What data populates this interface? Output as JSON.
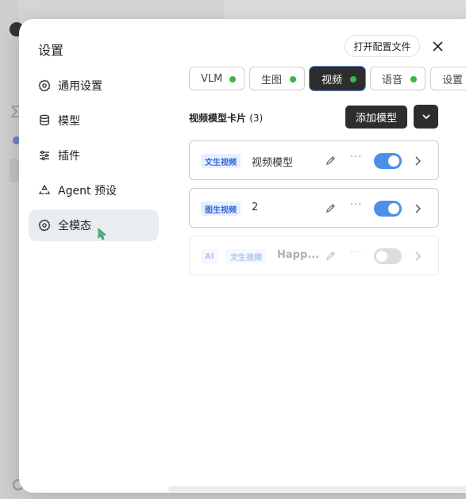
{
  "sidebar": {
    "title": "设置",
    "items": [
      {
        "label": "通用设置",
        "icon": "gear-icon"
      },
      {
        "label": "模型",
        "icon": "database-icon"
      },
      {
        "label": "插件",
        "icon": "sliders-icon"
      },
      {
        "label": "Agent 预设",
        "icon": "recycle-icon"
      },
      {
        "label": "全模态",
        "icon": "gear-icon",
        "active": true
      }
    ]
  },
  "header": {
    "open_config_label": "打开配置文件",
    "close_icon": "close-icon"
  },
  "tabs": [
    {
      "label": "VLM",
      "status": "green"
    },
    {
      "label": "生图",
      "status": "green"
    },
    {
      "label": "视频",
      "status": "green",
      "active": true
    },
    {
      "label": "语音",
      "status": "green"
    },
    {
      "label": "设置"
    }
  ],
  "section": {
    "title": "视频模型卡片",
    "count": "(3)",
    "add_model_label": "添加模型"
  },
  "cards": [
    {
      "badges": [
        "文生视频"
      ],
      "name": "视频模型",
      "enabled": true,
      "disabled": false
    },
    {
      "badges": [
        "图生视频"
      ],
      "name": "2",
      "enabled": true,
      "disabled": false
    },
    {
      "badges": [
        "AI",
        "文生视频"
      ],
      "name": "Happ...",
      "enabled": false,
      "disabled": true
    }
  ],
  "colors": {
    "accent": "#4c8fe8",
    "status_green": "#36b84a",
    "dark_button": "#2d2d2d",
    "badge_bg": "#e6efff",
    "badge_text": "#2f68d8"
  }
}
